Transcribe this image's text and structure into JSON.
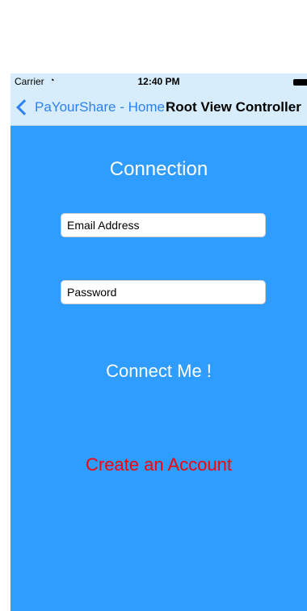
{
  "status_bar": {
    "carrier": "Carrier",
    "time": "12:40 PM"
  },
  "nav_bar": {
    "back_label": "PaYourShare - Home",
    "title": "Root View Controller"
  },
  "main": {
    "heading": "Connection",
    "email_placeholder": "Email Address",
    "password_placeholder": "Password",
    "connect_label": "Connect Me !",
    "create_account_label": "Create an Account"
  },
  "colors": {
    "background": "#2f9cff",
    "nav_background": "#d7edfb",
    "link_blue": "#2d80f1",
    "create_account_red": "#ff0000"
  },
  "icons": [
    "wifi-icon",
    "battery-icon",
    "chevron-left-icon"
  ]
}
